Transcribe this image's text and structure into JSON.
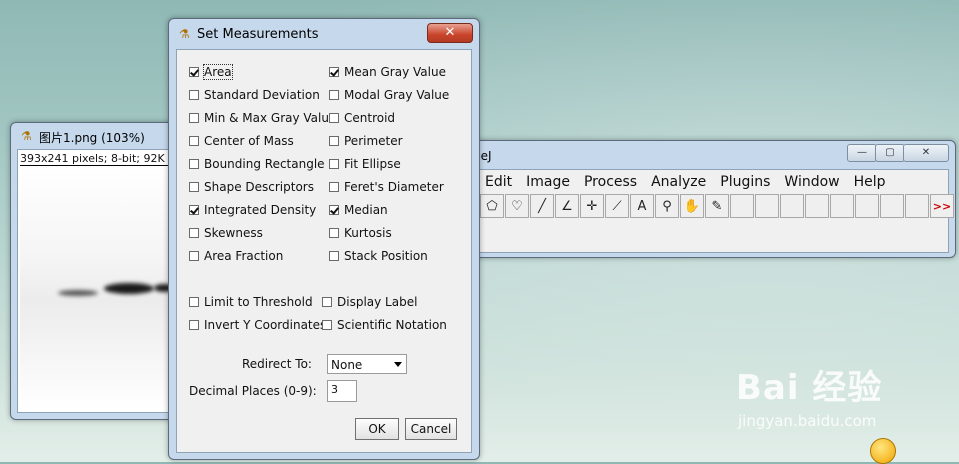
{
  "image_window": {
    "title": "图片1.png (103%)",
    "info": "393x241 pixels; 8-bit; 92K"
  },
  "imagej_window": {
    "title_fragment": "geJ",
    "menus": [
      "Edit",
      "Image",
      "Process",
      "Analyze",
      "Plugins",
      "Window",
      "Help"
    ],
    "tools": [
      "polygon-tool-icon",
      "freehand-tool-icon",
      "line-tool-icon",
      "angle-tool-icon",
      "point-tool-icon",
      "wand-tool-icon",
      "text-tool-icon",
      "magnifier-tool-icon",
      "hand-tool-icon",
      "dropper-tool-icon",
      "",
      "",
      "",
      "",
      "",
      "",
      "",
      "",
      "more-tools-icon"
    ],
    "more_label": ">>"
  },
  "dialog": {
    "title": "Set Measurements",
    "close_label": "✕",
    "left_column": [
      {
        "label": "Area",
        "checked": true
      },
      {
        "label": "Standard Deviation",
        "checked": false
      },
      {
        "label": "Min & Max Gray Value",
        "checked": false
      },
      {
        "label": "Center of Mass",
        "checked": false
      },
      {
        "label": "Bounding Rectangle",
        "checked": false
      },
      {
        "label": "Shape Descriptors",
        "checked": false
      },
      {
        "label": "Integrated Density",
        "checked": true
      },
      {
        "label": "Skewness",
        "checked": false
      },
      {
        "label": "Area Fraction",
        "checked": false
      }
    ],
    "right_column": [
      {
        "label": "Mean Gray Value",
        "checked": true
      },
      {
        "label": "Modal Gray Value",
        "checked": false
      },
      {
        "label": "Centroid",
        "checked": false
      },
      {
        "label": "Perimeter",
        "checked": false
      },
      {
        "label": "Fit Ellipse",
        "checked": false
      },
      {
        "label": "Feret's Diameter",
        "checked": false
      },
      {
        "label": "Median",
        "checked": true
      },
      {
        "label": "Kurtosis",
        "checked": false
      },
      {
        "label": "Stack Position",
        "checked": false
      }
    ],
    "options": [
      {
        "label": "Limit to Threshold",
        "checked": false
      },
      {
        "label": "Display Label",
        "checked": false
      },
      {
        "label": "Invert Y Coordinates",
        "checked": false
      },
      {
        "label": "Scientific Notation",
        "checked": false
      }
    ],
    "redirect_label": "Redirect To:",
    "redirect_value": "None",
    "decimal_label": "Decimal Places (0-9):",
    "decimal_value": "3",
    "ok_label": "OK",
    "cancel_label": "Cancel"
  },
  "watermark": {
    "brand": "Bai 经验",
    "url": "jingyan.baidu.com"
  }
}
